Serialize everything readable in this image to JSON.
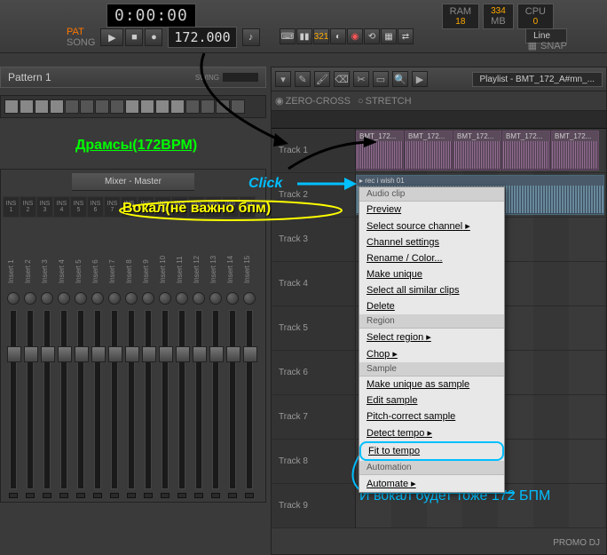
{
  "top": {
    "time": "0:00:00",
    "ram": "RAM",
    "ram_val": "18",
    "cpu": "CPU",
    "cpu_val": "0",
    "poly_val": "334",
    "mb": "MB",
    "pat": "PAT",
    "song": "SONG",
    "tempo": "172.000",
    "line": "Line",
    "snap": "SNAP",
    "tool_321": "321"
  },
  "pattern": {
    "title": "Pattern 1",
    "swing": "SWING"
  },
  "mixer": {
    "title": "Mixer - Master",
    "ins": [
      "INS 1",
      "INS 2",
      "INS 3",
      "INS 4",
      "INS 5",
      "INS 6",
      "INS 7",
      "INS 8",
      "INS 9",
      "INS 10",
      "INS 11",
      "INS 12",
      "INS 13",
      "INS 14",
      "INS 15"
    ],
    "inserts": [
      "Insert 1",
      "Insert 2",
      "Insert 3",
      "Insert 4",
      "Insert 5",
      "Insert 6",
      "Insert 7",
      "Insert 8",
      "Insert 9",
      "Insert 10",
      "Insert 11",
      "Insert 12",
      "Insert 13",
      "Insert 14",
      "Insert 15"
    ]
  },
  "playlist": {
    "title": "Playlist - BMT_172_A#mn_...",
    "zero_cross": "ZERO-CROSS",
    "stretch": "STRETCH",
    "tracks": [
      "Track 1",
      "Track 2",
      "Track 3",
      "Track 4",
      "Track 5",
      "Track 6",
      "Track 7",
      "Track 8",
      "Track 9"
    ],
    "clip_drums": "BMT_172...",
    "clip_vocal": "rec i wish 01"
  },
  "menu": {
    "s1": "Audio clip",
    "preview": "Preview",
    "select_source": "Select source channel",
    "channel_settings": "Channel settings",
    "rename": "Rename / Color...",
    "make_unique": "Make unique",
    "select_similar": "Select all similar clips",
    "delete": "Delete",
    "s2": "Region",
    "select_region": "Select region",
    "chop": "Chop",
    "s3": "Sample",
    "make_unique_sample": "Make unique as sample",
    "edit_sample": "Edit sample",
    "pitch_correct": "Pitch-correct sample",
    "detect_tempo": "Detect tempo",
    "fit_to_tempo": "Fit to tempo",
    "s4": "Automation",
    "automate": "Automate"
  },
  "annotations": {
    "drums": "Драмсы(172BPM)",
    "vocal": "Вокал(не важно бпм)",
    "click": "Click",
    "result": "И вокал будет тоже 172 БПМ"
  },
  "watermark": "PROMO DJ"
}
